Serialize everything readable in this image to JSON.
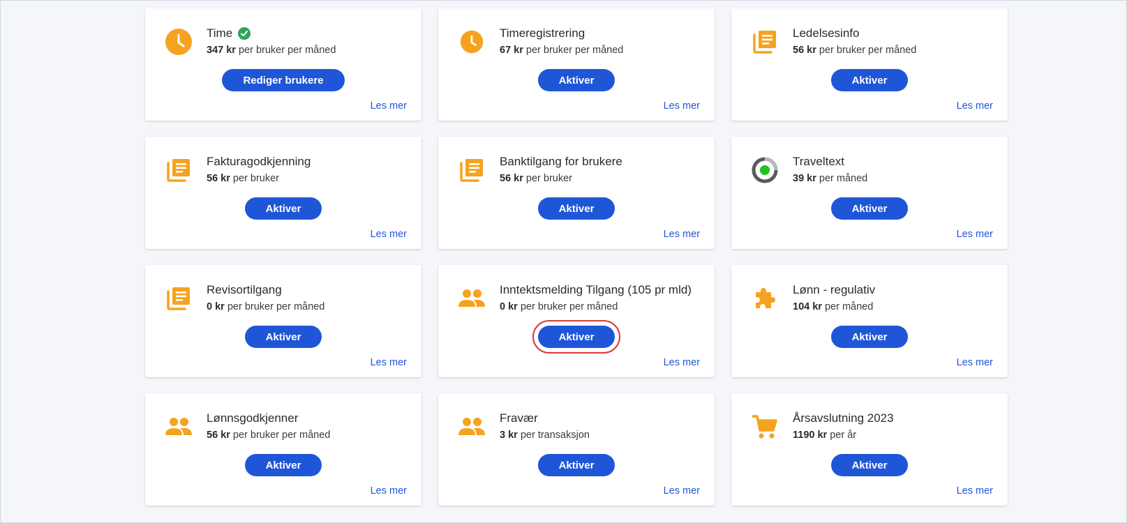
{
  "colors": {
    "accent": "#1f56d8",
    "icon": "#f5a31f",
    "check": "#2ea45c",
    "highlight_box": "#d33a3a"
  },
  "cards": [
    {
      "title": "Time",
      "active": true,
      "price_amount": "347 kr",
      "price_suffix": " per bruker per måned",
      "button": "Rediger brukere",
      "link": "Les mer",
      "icon": "clock-icon"
    },
    {
      "title": "Timeregistrering",
      "price_amount": "67 kr",
      "price_suffix": " per bruker per måned",
      "button": "Aktiver",
      "link": "Les mer",
      "icon": "clock-icon"
    },
    {
      "title": "Ledelsesinfo",
      "price_amount": "56 kr",
      "price_suffix": " per bruker per måned",
      "button": "Aktiver",
      "link": "Les mer",
      "icon": "document-stack-icon"
    },
    {
      "title": "Fakturagodkjenning",
      "price_amount": "56 kr",
      "price_suffix": " per bruker",
      "button": "Aktiver",
      "link": "Les mer",
      "icon": "document-stack-icon"
    },
    {
      "title": "Banktilgang for brukere",
      "price_amount": "56 kr",
      "price_suffix": " per bruker",
      "button": "Aktiver",
      "link": "Les mer",
      "icon": "document-stack-icon"
    },
    {
      "title": "Traveltext",
      "price_amount": "39 kr",
      "price_suffix": " per måned",
      "button": "Aktiver",
      "link": "Les mer",
      "icon": "traveltext-logo-icon"
    },
    {
      "title": "Revisortilgang",
      "price_amount": "0 kr",
      "price_suffix": " per bruker per måned",
      "button": "Aktiver",
      "link": "Les mer",
      "icon": "document-stack-icon"
    },
    {
      "title": "Inntektsmelding Tilgang (105 pr mld)",
      "price_amount": "0 kr",
      "price_suffix": " per bruker per måned",
      "button": "Aktiver",
      "link": "Les mer",
      "icon": "people-icon",
      "highlighted": true
    },
    {
      "title": "Lønn - regulativ",
      "price_amount": "104 kr",
      "price_suffix": " per måned",
      "button": "Aktiver",
      "link": "Les mer",
      "icon": "puzzle-icon"
    },
    {
      "title": "Lønnsgodkjenner",
      "price_amount": "56 kr",
      "price_suffix": " per bruker per måned",
      "button": "Aktiver",
      "link": "Les mer",
      "icon": "people-icon"
    },
    {
      "title": "Fravær",
      "price_amount": "3 kr",
      "price_suffix": " per transaksjon",
      "button": "Aktiver",
      "link": "Les mer",
      "icon": "people-icon"
    },
    {
      "title": "Årsavslutning 2023",
      "price_amount": "1190 kr",
      "price_suffix": " per år",
      "button": "Aktiver",
      "link": "Les mer",
      "icon": "cart-icon"
    }
  ]
}
